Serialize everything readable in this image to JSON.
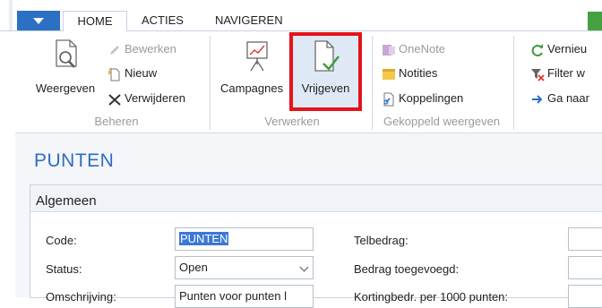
{
  "tabs": {
    "home": "HOME",
    "acties": "ACTIES",
    "navigeren": "NAVIGEREN"
  },
  "ribbon": {
    "weergeven": "Weergeven",
    "bewerken": "Bewerken",
    "nieuw": "Nieuw",
    "verwijderen": "Verwijderen",
    "group_beheren": "Beheren",
    "campagnes": "Campagnes",
    "vrijgeven": "Vrijgeven",
    "group_verwerken": "Verwerken",
    "onenote": "OneNote",
    "notities": "Notities",
    "koppelingen": "Koppelingen",
    "group_gekoppeld": "Gekoppeld weergeven",
    "vernieuwen": "Vernieu",
    "filter": "Filter w",
    "ganaar": "Ga naar"
  },
  "page": {
    "title": "PUNTEN"
  },
  "fasttab": {
    "title": "Algemeen",
    "code_label": "Code:",
    "code_value": "PUNTEN",
    "status_label": "Status:",
    "status_value": "Open",
    "omschrijving_label": "Omschrijving:",
    "omschrijving_value": "Punten voor punten l",
    "telbedrag_label": "Telbedrag:",
    "bedrag_label": "Bedrag toegevoegd:",
    "korting_label": "Kortingbedr. per 1000 punten:"
  },
  "colors": {
    "accent": "#2b70c2",
    "highlight": "#e4131b",
    "title": "#2f6dbd"
  }
}
